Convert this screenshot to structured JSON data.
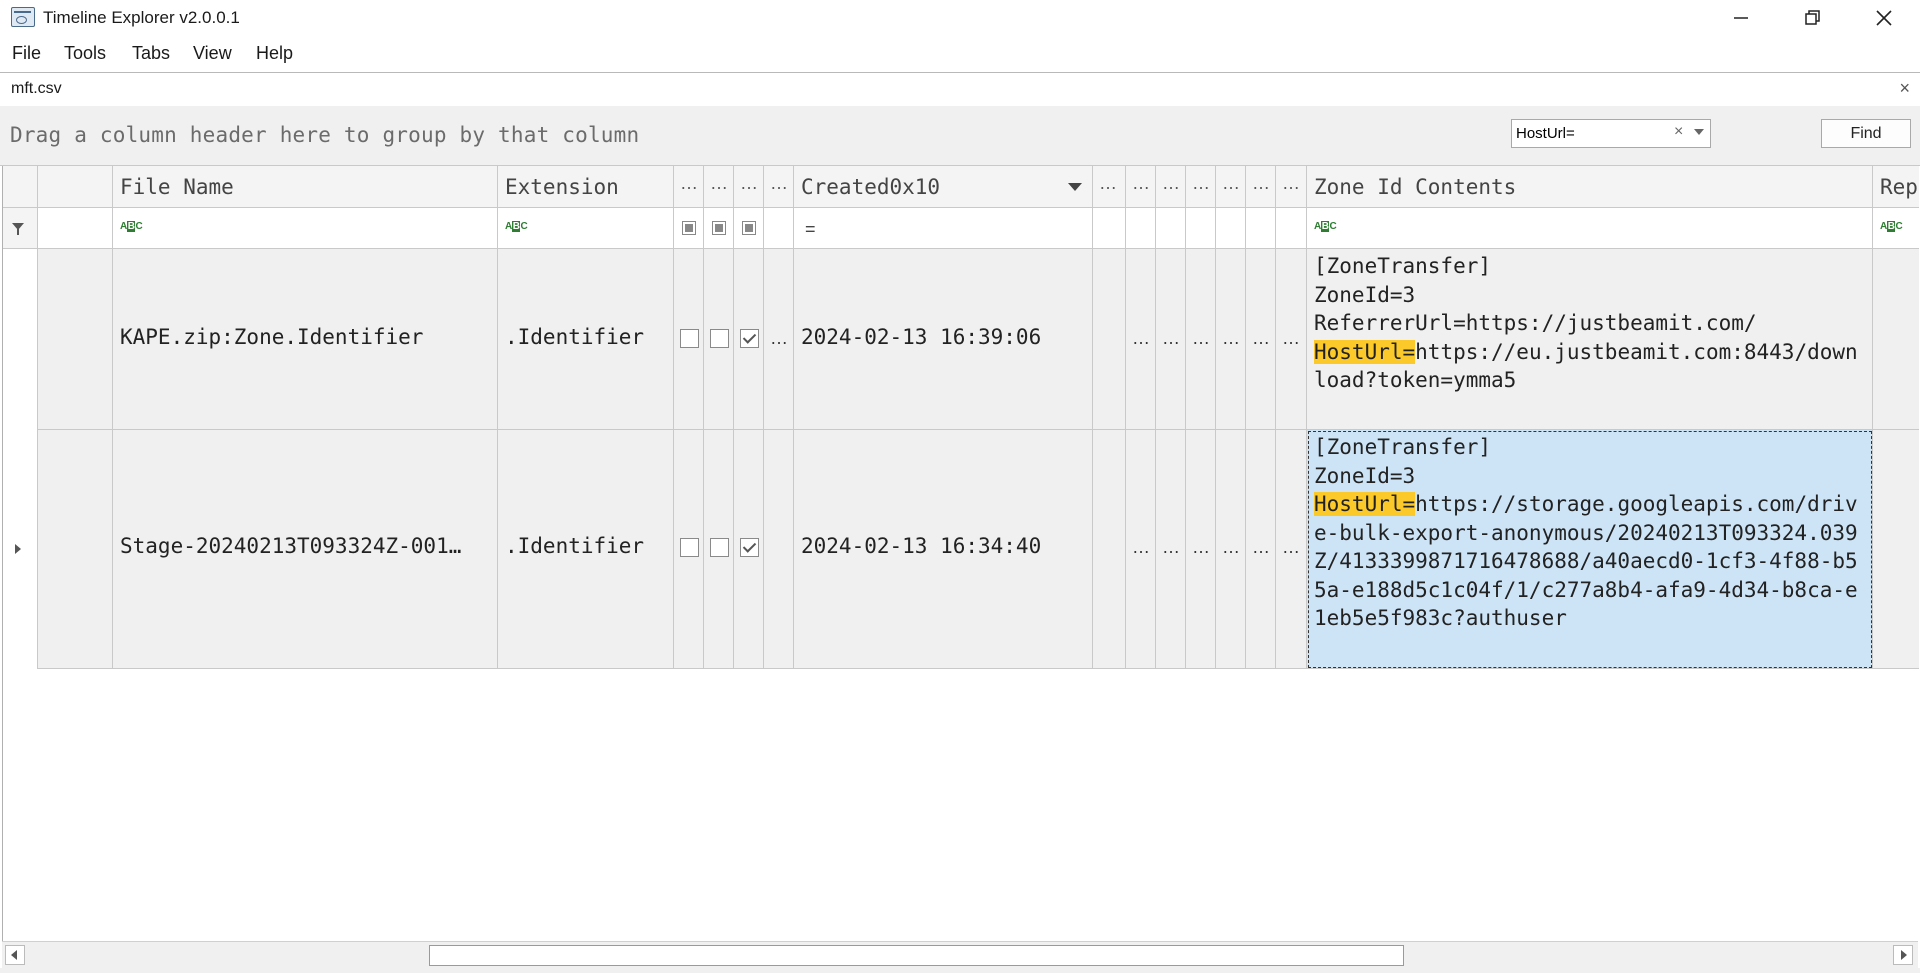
{
  "window": {
    "title": "Timeline Explorer v2.0.0.1",
    "controls": [
      "minimize-icon",
      "restore-icon",
      "close-icon"
    ]
  },
  "menu": {
    "file": "File",
    "tools": "Tools",
    "tabs": "Tabs",
    "view": "View",
    "help": "Help"
  },
  "doc_tab": {
    "label": "mft.csv",
    "close": "×"
  },
  "group_panel": {
    "hint": "Drag a column header here to group by that column",
    "search_value": "HostUrl=",
    "search_clear": "×",
    "find_label": "Find"
  },
  "columns": {
    "file_name": "File Name",
    "extension": "Extension",
    "collapsed": "…",
    "created": "Created0x10",
    "zone_id": "Zone Id Contents",
    "rep": "Rep"
  },
  "filter": {
    "abc": "ABC",
    "equals": "="
  },
  "rows": [
    {
      "file_name": "KAPE.zip:Zone.Identifier",
      "extension": ".Identifier",
      "checks": [
        false,
        false,
        true
      ],
      "created": "2024-02-13 16:39:06",
      "zone_line1": "[ZoneTransfer]",
      "zone_line2": "ZoneId=3",
      "zone_line3": "ReferrerUrl=https://justbeamit.com/",
      "zone_highlight": "HostUrl=",
      "zone_rest": "https://eu.justbeamit.com:8443/download?token=ymma5",
      "selected": false
    },
    {
      "file_name": "Stage-20240213T093324Z-001…",
      "extension": ".Identifier",
      "checks": [
        false,
        false,
        true
      ],
      "created": "2024-02-13 16:34:40",
      "zone_line1": "[ZoneTransfer]",
      "zone_line2": "ZoneId=3",
      "zone_highlight": "HostUrl=",
      "zone_rest": "https://storage.googleapis.com/drive-bulk-export-anonymous/20240213T093324.039Z/4133399871716478688/a40aecd0-1cf3-4f88-b55a-e188d5c1c04f/1/c277a8b4-afa9-4d34-b8ca-e1eb5e5f983c?authuser",
      "selected": true
    }
  ],
  "colors": {
    "highlight": "#fcc92b",
    "selection": "#cde4f7",
    "row_bg": "#f0f0f0"
  }
}
